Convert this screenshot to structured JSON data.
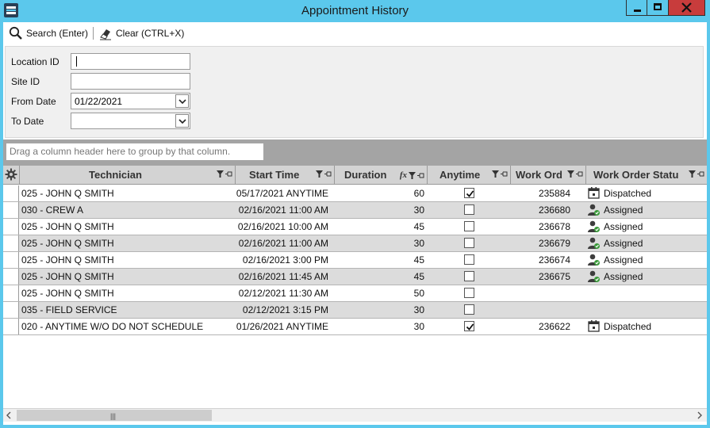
{
  "window": {
    "title": "Appointment History"
  },
  "toolbar": {
    "search_label": "Search (Enter)",
    "clear_label": "Clear (CTRL+X)"
  },
  "filters": {
    "location_id": {
      "label": "Location ID",
      "value": ""
    },
    "site_id": {
      "label": "Site ID",
      "value": ""
    },
    "from_date": {
      "label": "From Date",
      "value": "01/22/2021"
    },
    "to_date": {
      "label": "To Date",
      "value": ""
    }
  },
  "grid": {
    "group_hint": "Drag a column header here to group by that column.",
    "columns": {
      "technician": "Technician",
      "start_time": "Start Time",
      "duration": "Duration",
      "anytime": "Anytime",
      "work_order": "Work Ord",
      "work_order_status": "Work Order Statu"
    },
    "rows": [
      {
        "technician": "025 - JOHN Q SMITH",
        "start_time": "05/17/2021 ANYTIME",
        "duration": "60",
        "anytime": true,
        "work_order": "235884",
        "status": "Dispatched",
        "status_icon": "calendar-icon"
      },
      {
        "technician": "030 - CREW A",
        "start_time": "02/16/2021 11:00 AM",
        "duration": "30",
        "anytime": false,
        "work_order": "236680",
        "status": "Assigned",
        "status_icon": "person-icon"
      },
      {
        "technician": "025 - JOHN Q SMITH",
        "start_time": "02/16/2021 10:00 AM",
        "duration": "45",
        "anytime": false,
        "work_order": "236678",
        "status": "Assigned",
        "status_icon": "person-icon"
      },
      {
        "technician": "025 - JOHN Q SMITH",
        "start_time": "02/16/2021 11:00 AM",
        "duration": "30",
        "anytime": false,
        "work_order": "236679",
        "status": "Assigned",
        "status_icon": "person-icon"
      },
      {
        "technician": "025 - JOHN Q SMITH",
        "start_time": "02/16/2021  3:00 PM",
        "duration": "45",
        "anytime": false,
        "work_order": "236674",
        "status": "Assigned",
        "status_icon": "person-icon"
      },
      {
        "technician": "025 - JOHN Q SMITH",
        "start_time": "02/16/2021 11:45 AM",
        "duration": "45",
        "anytime": false,
        "work_order": "236675",
        "status": "Assigned",
        "status_icon": "person-icon"
      },
      {
        "technician": "025 - JOHN Q SMITH",
        "start_time": "02/12/2021 11:30 AM",
        "duration": "50",
        "anytime": false,
        "work_order": "",
        "status": "",
        "status_icon": ""
      },
      {
        "technician": "035 - FIELD SERVICE",
        "start_time": "02/12/2021  3:15 PM",
        "duration": "30",
        "anytime": false,
        "work_order": "",
        "status": "",
        "status_icon": ""
      },
      {
        "technician": "020 - ANYTIME W/O DO NOT SCHEDULE",
        "start_time": "01/26/2021 ANYTIME",
        "duration": "30",
        "anytime": true,
        "work_order": "236622",
        "status": "Dispatched",
        "status_icon": "calendar-icon"
      }
    ]
  },
  "colors": {
    "titlebar": "#5bc8ec",
    "close_button": "#c83c3c",
    "alt_row": "#dcdcdc",
    "header": "#d3d3d3"
  }
}
